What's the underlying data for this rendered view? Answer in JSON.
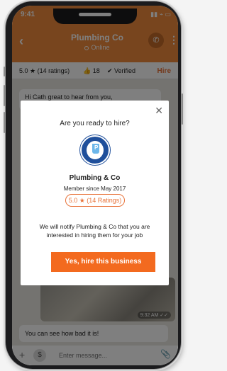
{
  "statusbar": {
    "time": "9:41",
    "icons": "▮▮ ⌁ ▭"
  },
  "header": {
    "title": "Plumbing Co",
    "status": "Online",
    "back_icon": "chevron-left-icon",
    "call_icon": "phone-icon",
    "more_icon": "more-vertical-icon"
  },
  "info_bar": {
    "rating": "5.0 ★ (14 ratings)",
    "likes": "👍 18",
    "verified": "✔ Verified",
    "hire_label": "Hire"
  },
  "chat": {
    "incoming_message": "Hi Cath great to hear from you,",
    "photo_time": "9:32 AM ✓✓",
    "caption": "You can see how bad it is!"
  },
  "input_bar": {
    "placeholder": "Enter message..."
  },
  "modal": {
    "question": "Are you ready to hire?",
    "business_name": "Plumbing & Co",
    "member_since": "Member since May 2017",
    "rating": "5.0 ★ (14 Ratings)",
    "notify_text": "We will notify Plumbing & Co that you are interested in hiring them for your job",
    "hire_button": "Yes, hire this business",
    "close_icon": "close-icon"
  },
  "colors": {
    "accent": "#f36a1f",
    "header": "#f08a3c",
    "logo_blue": "#1f4f9b"
  }
}
